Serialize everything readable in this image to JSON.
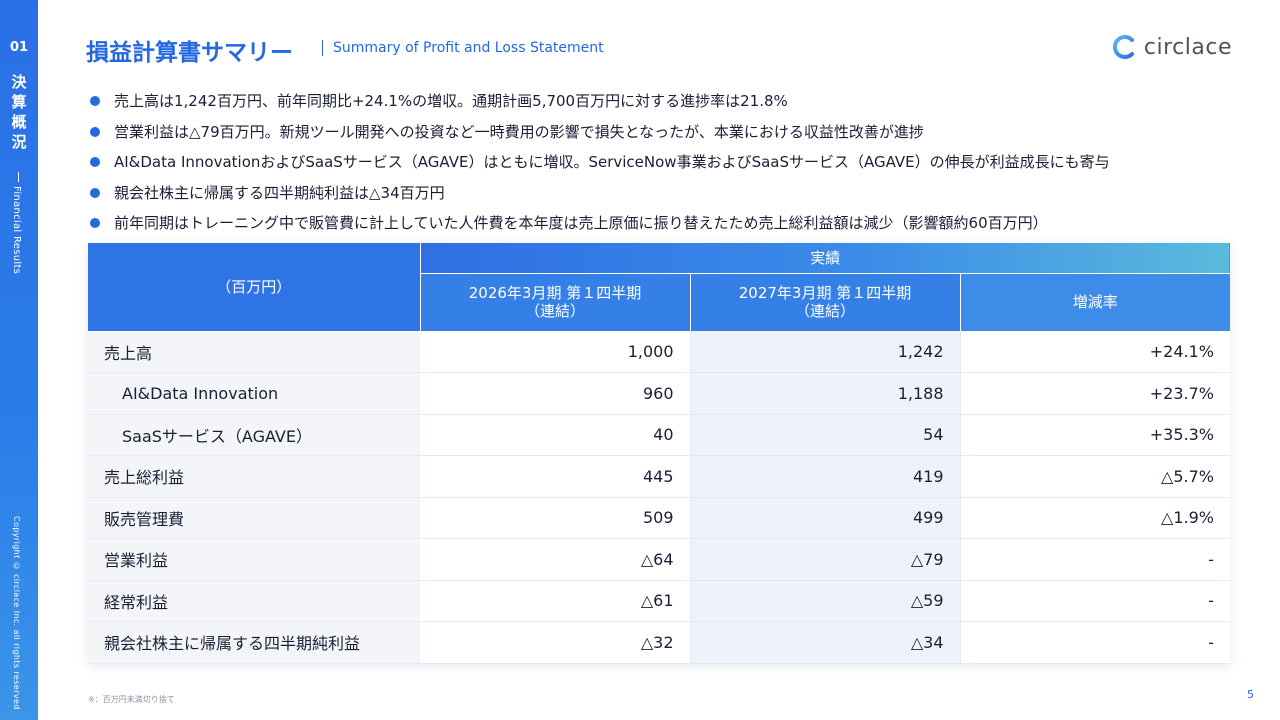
{
  "sidebar": {
    "number": "01",
    "kanji": [
      "決",
      "算",
      "概",
      "況"
    ],
    "english": "Financial Results",
    "copyright": "Copyright © circlace Inc. all rights reserved"
  },
  "header": {
    "title": "損益計算書サマリー",
    "subtitle": "Summary of Profit and Loss Statement",
    "logo_text": "circlace"
  },
  "bullets": [
    "売上高は1,242百万円、前年同期比+24.1%の増収。通期計画5,700百万円に対する進捗率は21.8%",
    "営業利益は△79百万円。新規ツール開発への投資など一時費用の影響で損失となったが、本業における収益性改善が進捗",
    "AI&Data InnovationおよびSaaSサービス（AGAVE）はともに増収。ServiceNow事業およびSaaSサービス（AGAVE）の伸長が利益成長にも寄与",
    "親会社株主に帰属する四半期純利益は△34百万円",
    "前年同期はトレーニング中で販管費に計上していた人件費を本年度は売上原価に振り替えたため売上総利益額は減少（影響額約60百万円）"
  ],
  "table": {
    "unit_label": "（百万円）",
    "group_header": "実績",
    "col1_line1": "2026年3月期 第１四半期",
    "col1_line2": "（連結）",
    "col2_line1": "2027年3月期 第１四半期",
    "col2_line2": "（連結）",
    "col3": "増減率",
    "rows": [
      {
        "label": "売上高",
        "v1": "1,000",
        "v2": "1,242",
        "v3": "+24.1%"
      },
      {
        "label": "AI&Data Innovation",
        "v1": "960",
        "v2": "1,188",
        "v3": "+23.7%"
      },
      {
        "label": "SaaSサービス（AGAVE）",
        "v1": "40",
        "v2": "54",
        "v3": "+35.3%"
      },
      {
        "label": "売上総利益",
        "v1": "445",
        "v2": "419",
        "v3": "△5.7%"
      },
      {
        "label": "販売管理費",
        "v1": "509",
        "v2": "499",
        "v3": "△1.9%"
      },
      {
        "label": "営業利益",
        "v1": "△64",
        "v2": "△79",
        "v3": "-"
      },
      {
        "label": "経常利益",
        "v1": "△61",
        "v2": "△59",
        "v3": "-"
      },
      {
        "label": "親会社株主に帰属する四半期純利益",
        "v1": "△32",
        "v2": "△34",
        "v3": "-"
      }
    ]
  },
  "footnote": "※：百万円未満切り捨て",
  "page_number": "5",
  "colors": {
    "accent": "#2469e0",
    "header_gradient_end": "#5bbadc"
  }
}
